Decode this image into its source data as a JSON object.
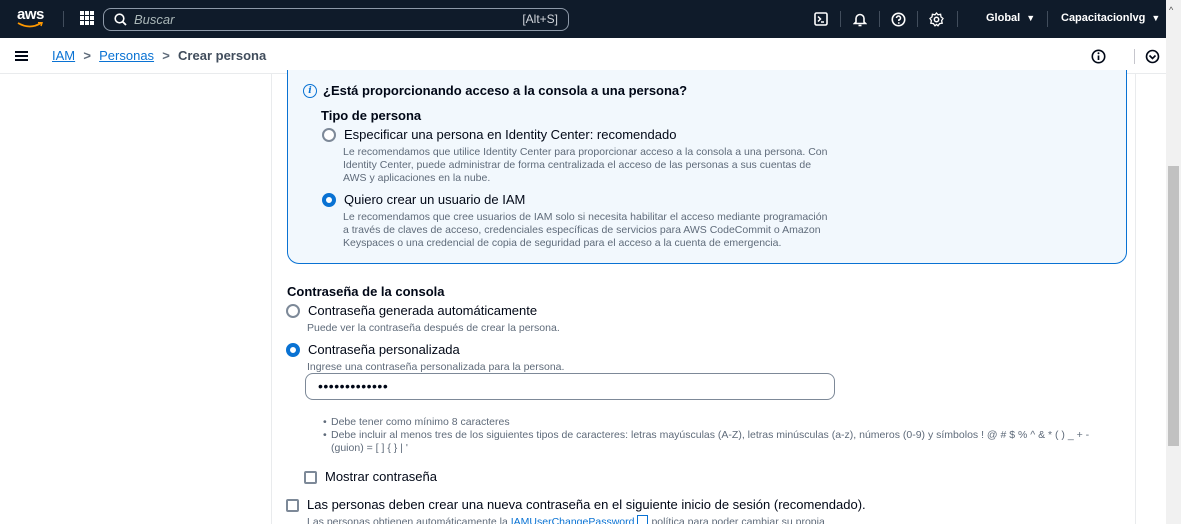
{
  "topnav": {
    "logo_text": "aws",
    "search_placeholder": "Buscar",
    "search_shortcut": "[Alt+S]",
    "region": "Global",
    "account": "Capacitacionlvg",
    "bg_color": "#0f1b2a"
  },
  "breadcrumb": {
    "items": [
      "IAM",
      "Personas"
    ],
    "current": "Crear persona"
  },
  "info_box": {
    "title": "¿Está proporcionando acceso a la consola a una persona?",
    "section_label": "Tipo de persona",
    "options": [
      {
        "label": "Especificar una persona en Identity Center: recomendado",
        "description_lines": [
          "Le recomendamos que utilice Identity Center para proporcionar acceso a la consola a una persona. Con",
          "Identity Center, puede administrar de forma centralizada el acceso de las personas a sus cuentas de",
          "AWS y aplicaciones en la nube."
        ],
        "selected": false
      },
      {
        "label": "Quiero crear un usuario de IAM",
        "description_lines": [
          "Le recomendamos que cree usuarios de IAM solo si necesita habilitar el acceso mediante programación",
          "a través de claves de acceso, credenciales específicas de servicios para AWS CodeCommit o Amazon",
          "Keyspaces o una credencial de copia de seguridad para el acceso a la cuenta de emergencia."
        ],
        "selected": true
      }
    ]
  },
  "console_password": {
    "label": "Contraseña de la consola",
    "options": [
      {
        "label": "Contraseña generada automáticamente",
        "description": "Puede ver la contraseña después de crear la persona.",
        "selected": false
      },
      {
        "label": "Contraseña personalizada",
        "description": "Ingrese una contraseña personalizada para la persona.",
        "selected": true
      }
    ],
    "password_value": "•••••••••••••",
    "requirements": [
      "Debe tener como mínimo 8 caracteres",
      "Debe incluir al menos tres de los siguientes tipos de caracteres: letras mayúsculas (A-Z), letras minúsculas (a-z), números (0-9) y símbolos ! @ # $ % ^ & * ( ) _ + -",
      "(guion) = [ ] { } | '"
    ],
    "show_password_label": "Mostrar contraseña",
    "show_password_checked": false
  },
  "require_reset": {
    "label": "Las personas deben crear una nueva contraseña en el siguiente inicio de sesión (recomendado).",
    "checked": false,
    "desc_prefix": "Las personas obtienen automáticamente la",
    "desc_link": "IAMUserChangePassword",
    "desc_suffix": "política para poder cambiar su propia"
  },
  "colors": {
    "accent": "#0972d3",
    "info_bg": "#f2f8fd",
    "muted_text": "#5f6b7a"
  }
}
